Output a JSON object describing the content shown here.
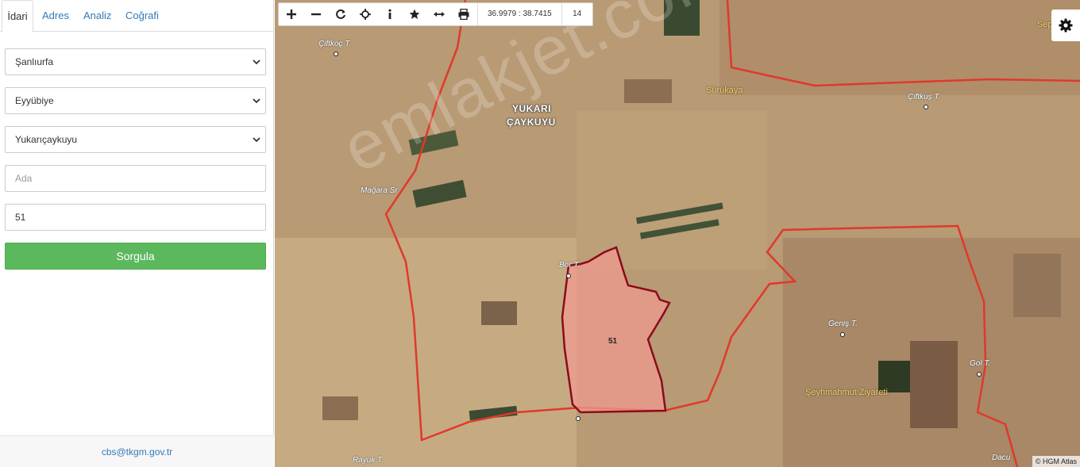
{
  "sidebar": {
    "tabs": [
      {
        "label": "İdari",
        "active": true
      },
      {
        "label": "Adres"
      },
      {
        "label": "Analiz"
      },
      {
        "label": "Coğrafi"
      }
    ],
    "province": "Şanlıurfa",
    "district": "Eyyübiye",
    "neighborhood": "Yukarıçaykuyu",
    "ada_placeholder": "Ada",
    "parsel_value": "51",
    "query_button": "Sorgula",
    "footer_link": "cbs@tkgm.gov.tr"
  },
  "map": {
    "coordinates": "36.9979 : 38.7415",
    "zoom": "14",
    "parcel_label": "51",
    "attribution": "© HGM Atlas",
    "watermark": "emlakjet.com",
    "place_labels": {
      "ciftkoc": "Çiftkoç T.",
      "yukari": "YUKARI",
      "caykuyu": "ÇAYKUYU",
      "surukaya": "Sürükaya",
      "ciftkus": "Çiftkuş T.",
      "magara": "Mağara Sr",
      "bor": "Bor T.",
      "genis": "Geniş T.",
      "seyhmahmut": "Şeyhmahmut Ziyareti",
      "gol": "Gol T.",
      "rayuk": "Rayuk T.",
      "dacu": "Dacu",
      "sep": "Sep"
    },
    "colors": {
      "boundary": "#e0392b",
      "parcel_fill": "#f19a90",
      "parcel_stroke": "#8b0a1e",
      "button_green": "#5cb85c"
    }
  }
}
